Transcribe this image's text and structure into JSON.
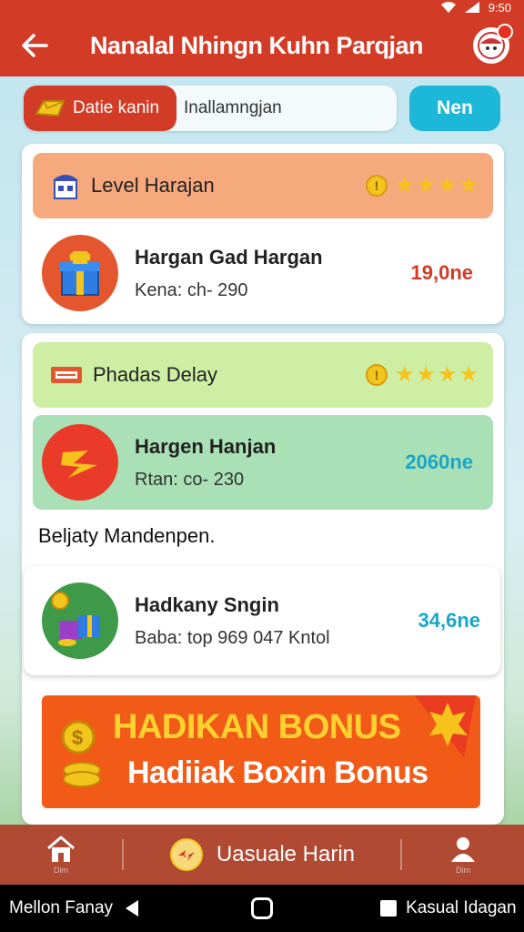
{
  "status_bar": {
    "time": "9:50"
  },
  "header": {
    "title": "Nanalal Nhingn Kuhn Parqjan"
  },
  "search": {
    "chip_label": "Datie kanin",
    "value": "Inallamngjan",
    "button_label": "Nen"
  },
  "card_top": {
    "level_label": "Level Harajan",
    "item_title": "Hargan Gad Hargan",
    "item_sub": "Kena: ch- 290",
    "item_price": "19,0ne"
  },
  "card_main": {
    "level_label": "Phadas Delay",
    "item_title": "Hargen Hanjan",
    "item_sub": "Rtan: co- 230",
    "item_price": "2060ne",
    "section_label": "Beljaty Mandenpen.",
    "inner_item_title": "Hadkany Sngin",
    "inner_item_sub": "Baba: top 969 047 Kntol",
    "inner_item_price": "34,6ne",
    "bonus_title": "HADIKAN BONUS",
    "bonus_subtitle": "Hadiiak Boxin Bonus"
  },
  "bottom_nav": {
    "home_label": "Dim",
    "center_label": "Uasuale Harin",
    "profile_label": "Dim"
  },
  "system_bar": {
    "left_label": "Mellon Fanay",
    "right_label": "Kasual Idagan"
  },
  "colors": {
    "accent": "#d23b26",
    "teal": "#1cb7d9",
    "bonus": "#f25b17",
    "star": "#f6c21b"
  },
  "ratings": {
    "card_top_stars": 4,
    "card_main_stars": 4
  }
}
